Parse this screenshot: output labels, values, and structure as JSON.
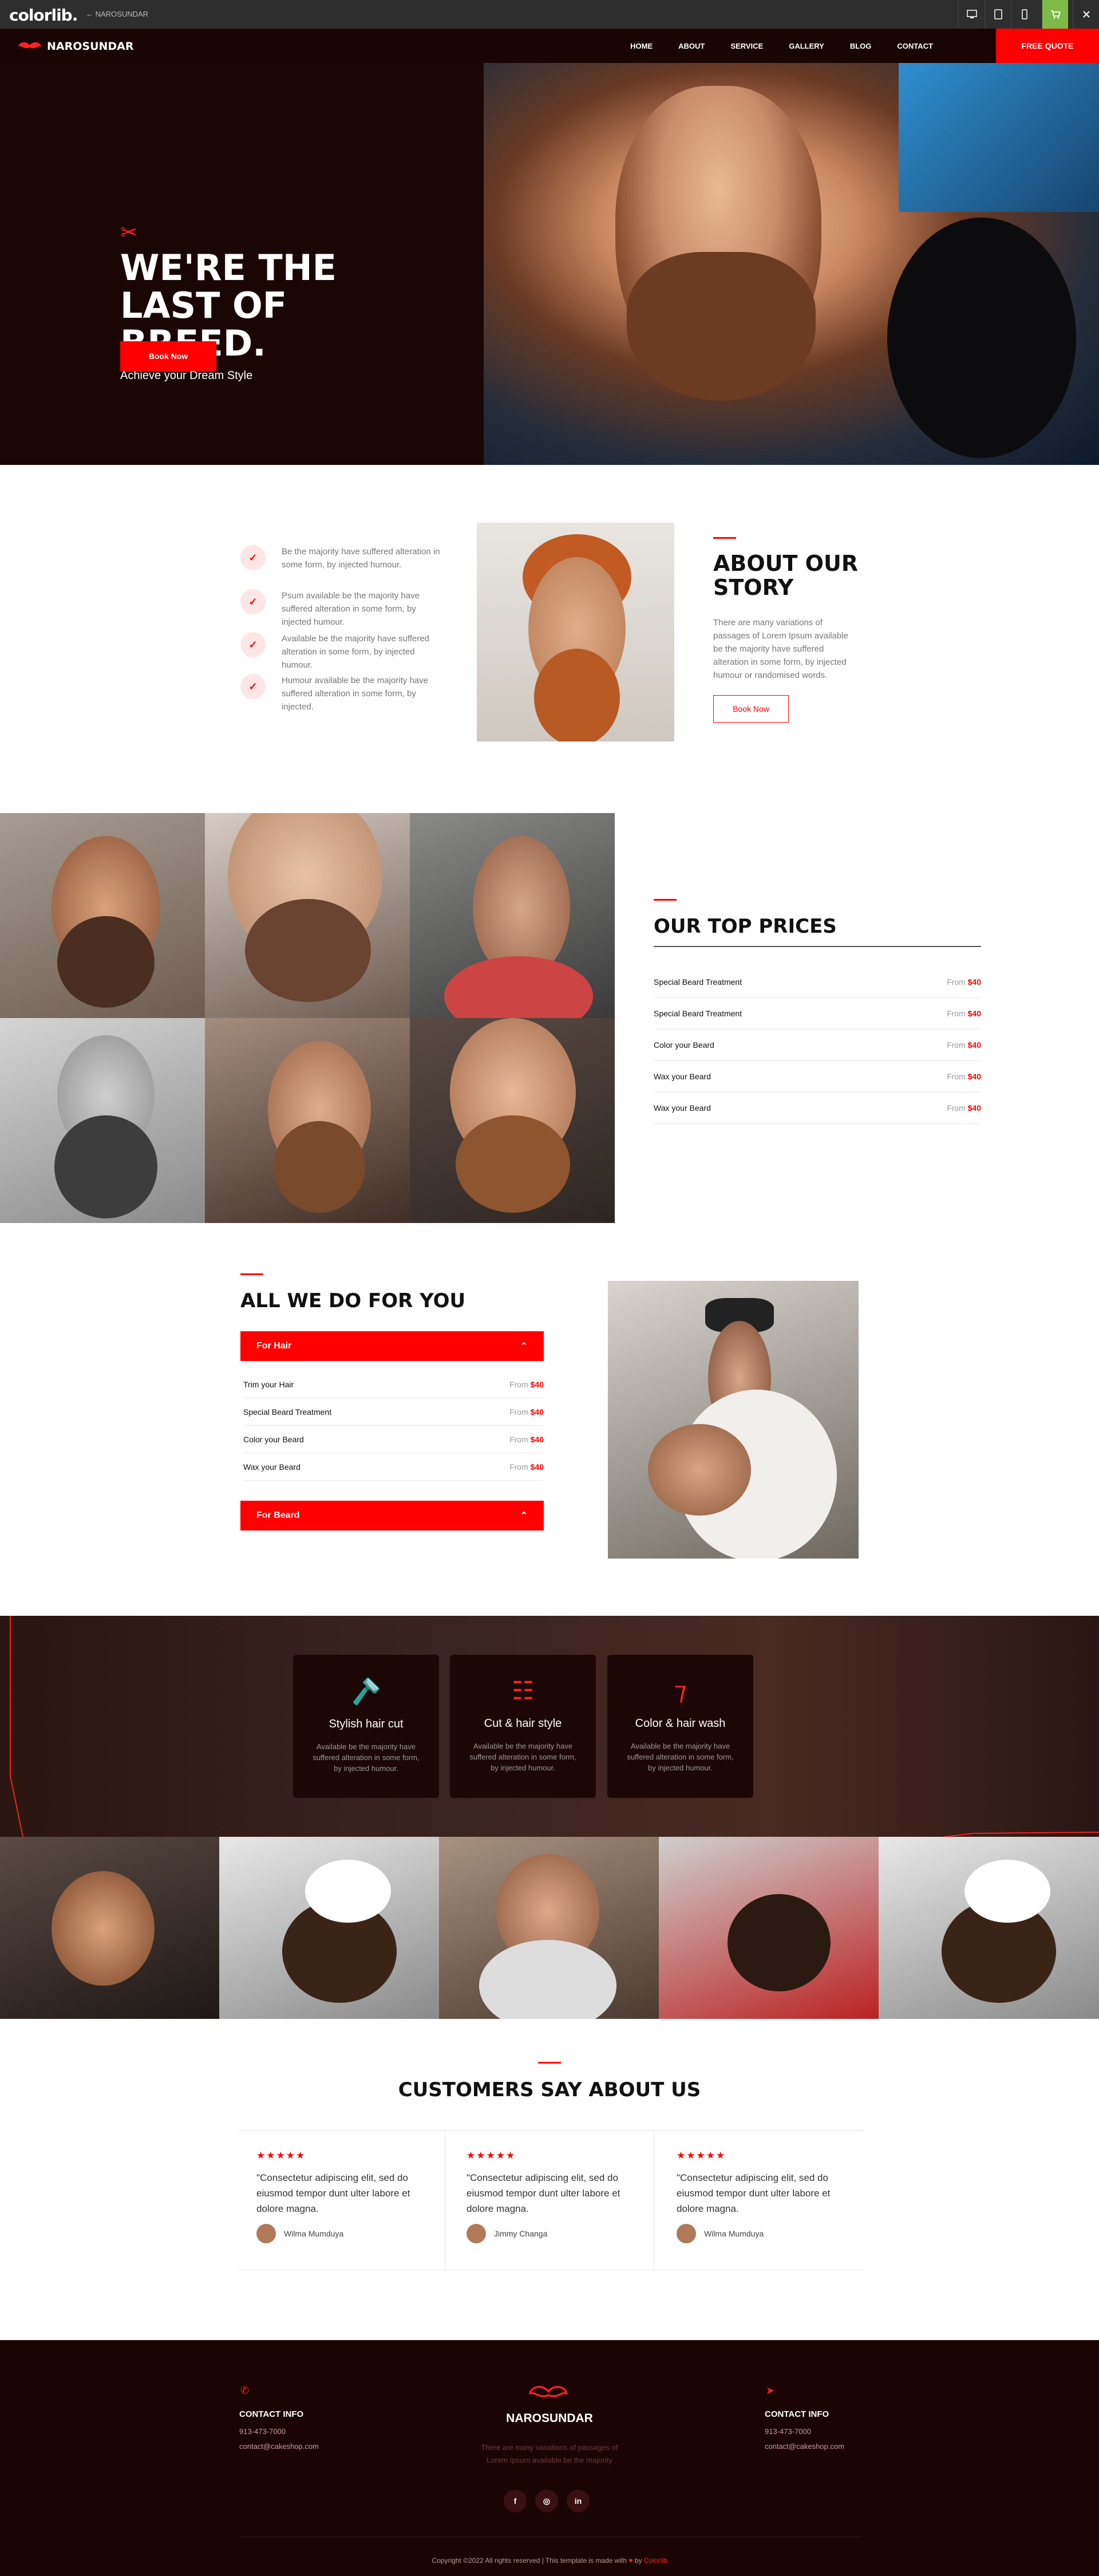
{
  "topbar": {
    "logo": "colorlib.",
    "crumb": "← NAROSUNDAR",
    "devices": [
      "desktop-icon",
      "tablet-icon",
      "mobile-icon",
      "cart-icon",
      "close-icon"
    ]
  },
  "nav": {
    "brand": "NAROSUNDAR",
    "items": [
      "HOME",
      "ABOUT",
      "SERVICE",
      "GALLERY",
      "BLOG",
      "CONTACT"
    ],
    "cta": "FREE QUOTE"
  },
  "hero": {
    "title": "WE'RE THE LAST OF BREED.",
    "subtitle": "Achieve your Dream Style",
    "button": "Book Now"
  },
  "about": {
    "checks": [
      "Be the majority have suffered alteration in some form, by injected humour.",
      "Psum available be the majority have suffered alteration in some form, by injected humour.",
      "Available be the majority have suffered alteration in some form, by injected humour.",
      "Humour available be the majority have suffered alteration in some form, by injected."
    ],
    "title": "ABOUT OUR STORY",
    "text": "There are many variations of passages of Lorem Ipsum available be the majority have suffered alteration in some form, by injected humour or randomised words.",
    "button": "Book Now"
  },
  "prices": {
    "title": "OUR TOP PRICES",
    "items": [
      {
        "name": "Special Beard Treatment",
        "from": "From",
        "price": "$40"
      },
      {
        "name": "Special Beard Treatment",
        "from": "From",
        "price": "$40"
      },
      {
        "name": "Color your Beard",
        "from": "From",
        "price": "$40"
      },
      {
        "name": "Wax your Beard",
        "from": "From",
        "price": "$40"
      },
      {
        "name": "Wax your Beard",
        "from": "From",
        "price": "$40"
      }
    ]
  },
  "services": {
    "title": "ALL WE DO FOR YOU",
    "hair_label": "For Hair",
    "beard_label": "For Beard",
    "items": [
      {
        "name": "Trim your Hair",
        "from": "From",
        "price": "$40"
      },
      {
        "name": "Special Beard Treatment",
        "from": "From",
        "price": "$40"
      },
      {
        "name": "Color your Beard",
        "from": "From",
        "price": "$40"
      },
      {
        "name": "Wax your Beard",
        "from": "From",
        "price": "$40"
      }
    ]
  },
  "features": [
    {
      "title": "Stylish hair cut",
      "text": "Available be the majority have suffered alteration in some form, by injected humour.",
      "icon": "razor-icon"
    },
    {
      "title": "Cut & hair style",
      "text": "Available be the majority have suffered alteration in some form, by injected humour.",
      "icon": "comb-icon"
    },
    {
      "title": "Color & hair wash",
      "text": "Available be the majority have suffered alteration in some form, by injected humour.",
      "icon": "straight-razor-icon"
    }
  ],
  "testimonials": {
    "title": "CUSTOMERS SAY ABOUT US",
    "stars": "★★★★★",
    "items": [
      {
        "quote": "\"Consectetur adipiscing elit, sed do eiusmod tempor dunt ulter labore et dolore magna.",
        "author": "Wilma Mumduya"
      },
      {
        "quote": "\"Consectetur adipiscing elit, sed do eiusmod tempor dunt ulter labore et dolore magna.",
        "author": "Jimmy Changa"
      },
      {
        "quote": "\"Consectetur adipiscing elit, sed do eiusmod tempor dunt ulter labore et dolore magna.",
        "author": "Wilma Mumduya"
      }
    ]
  },
  "footer": {
    "contact_left": {
      "title": "CONTACT INFO",
      "phone": "913-473-7000",
      "email": "contact@cakeshop.com"
    },
    "contact_right": {
      "title": "CONTACT INFO",
      "phone": "913-473-7000",
      "email": "contact@cakeshop.com"
    },
    "brand": "NAROSUNDAR",
    "about": "There are many variations of passages of Lorem Ipsum available be the majority",
    "social": [
      "f",
      "◎",
      "in"
    ],
    "copyright": "Copyright ©2022 All rights reserved | This template is made with",
    "by": "by",
    "credit": "Colorlib"
  },
  "colors": {
    "accent": "#ff0000",
    "dark": "#1b0404",
    "topbar": "#2e2e2e"
  }
}
